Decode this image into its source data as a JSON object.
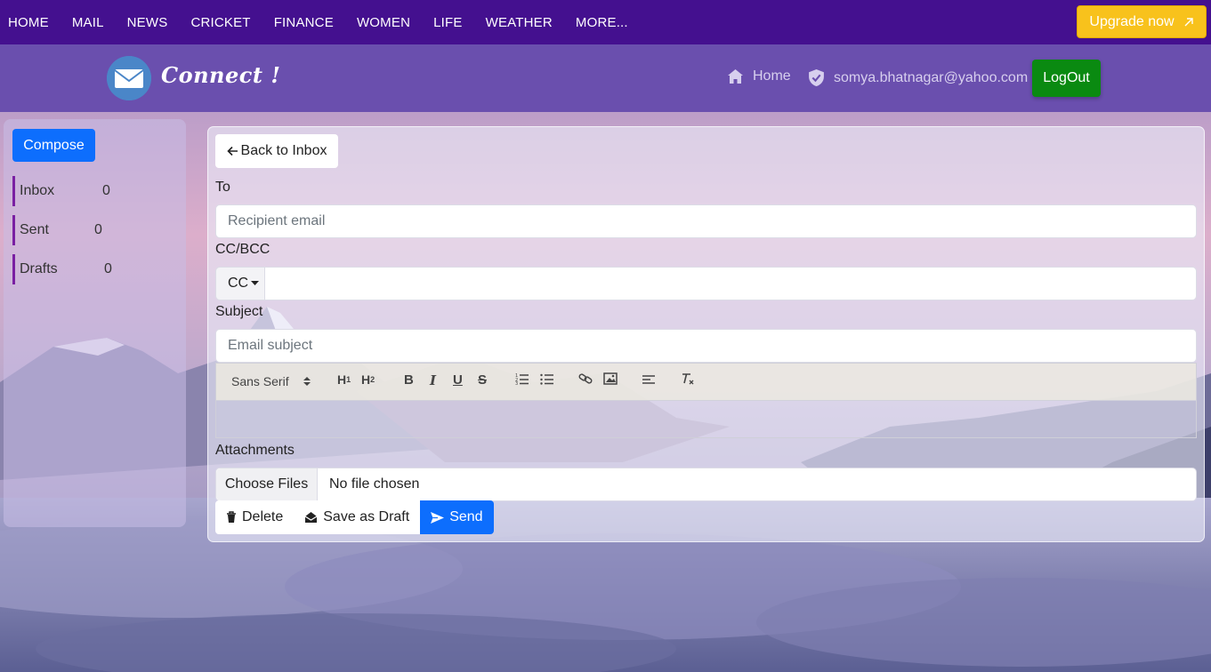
{
  "topnav": {
    "links": [
      "HOME",
      "MAIL",
      "NEWS",
      "CRICKET",
      "FINANCE",
      "WOMEN",
      "LIFE",
      "WEATHER",
      "MORE..."
    ],
    "upgrade_label": "Upgrade now"
  },
  "header": {
    "brand": "Connect !",
    "home_label": "Home",
    "user_email": "somya.bhatnagar@yahoo.com",
    "logout_label": "LogOut"
  },
  "sidebar": {
    "compose_label": "Compose",
    "folders": [
      {
        "name": "Inbox",
        "count": "0"
      },
      {
        "name": "Sent",
        "count": "0"
      },
      {
        "name": "Drafts",
        "count": "0"
      }
    ]
  },
  "compose": {
    "back_label": "Back to Inbox",
    "to_label": "To",
    "to_placeholder": "Recipient email",
    "ccbcc_label": "CC/BCC",
    "cc_selected": "CC",
    "subject_label": "Subject",
    "subject_placeholder": "Email subject",
    "toolbar": {
      "font_value": "Sans Serif",
      "icons": [
        "h1-icon",
        "h2-icon",
        "bold-icon",
        "italic-icon",
        "underline-icon",
        "strike-icon",
        "ordered-list-icon",
        "bullet-list-icon",
        "link-icon",
        "image-icon",
        "align-icon",
        "clear-format-icon"
      ]
    },
    "attachments_label": "Attachments",
    "choose_files_label": "Choose Files",
    "no_file_label": "No file chosen",
    "delete_label": "Delete",
    "save_draft_label": "Save as Draft",
    "send_label": "Send"
  },
  "colors": {
    "topnav_bg": "#44108f",
    "header_bg": "#6a4fae",
    "upgrade_bg": "#f8c21c",
    "logout_bg": "#0a8a11",
    "primary": "#0d6efd",
    "folder_accent": "#7a1fa3"
  }
}
